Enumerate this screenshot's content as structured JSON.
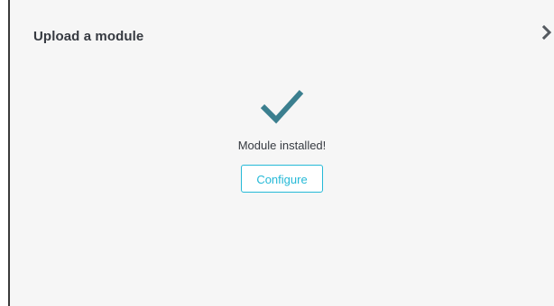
{
  "modal": {
    "title": "Upload a module",
    "close_icon": "chevron-right-icon",
    "status_icon": "checkmark-icon",
    "status_text": "Module installed!",
    "configure_label": "Configure"
  },
  "colors": {
    "accent": "#25b9d7",
    "check": "#3b7f8f",
    "title": "#363a41",
    "modal_bg": "#f6f6f6"
  }
}
